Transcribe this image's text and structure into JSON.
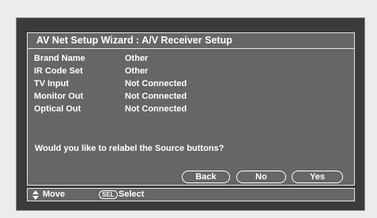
{
  "wizard": {
    "title": "AV Net Setup Wizard : A/V Receiver Setup",
    "settings": [
      {
        "label": "Brand Name",
        "value": "Other"
      },
      {
        "label": "IR Code Set",
        "value": "Other"
      },
      {
        "label": "TV Input",
        "value": "Not Connected"
      },
      {
        "label": "Monitor Out",
        "value": "Not Connected"
      },
      {
        "label": "Optical Out",
        "value": "Not Connected"
      }
    ],
    "question": "Would you like to relabel the Source buttons?",
    "buttons": {
      "back": "Back",
      "no": "No",
      "yes": "Yes"
    }
  },
  "footer": {
    "move_label": "Move",
    "sel_icon_text": "SEL",
    "select_label": "Select",
    "move_icon": "up-down-arrows-icon"
  }
}
